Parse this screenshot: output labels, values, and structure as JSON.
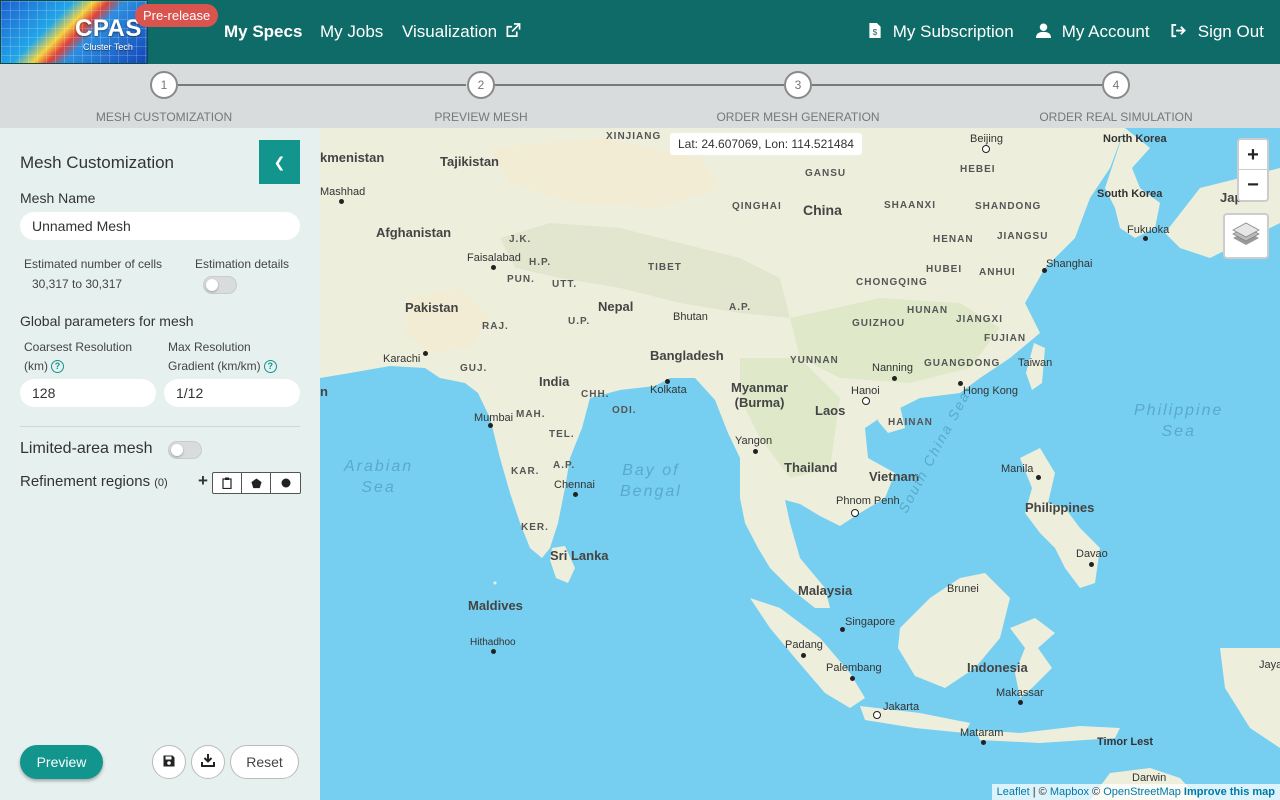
{
  "navbar": {
    "logo_text": "CPAS",
    "logo_sub": "Cluster Tech",
    "badge": "Pre-release",
    "links": [
      "My Specs",
      "My Jobs",
      "Visualization"
    ],
    "right_links": [
      "My Subscription",
      "My Account",
      "Sign Out"
    ]
  },
  "stepper": {
    "steps": [
      {
        "num": "1",
        "label": "MESH CUSTOMIZATION"
      },
      {
        "num": "2",
        "label": "PREVIEW MESH"
      },
      {
        "num": "3",
        "label": "ORDER MESH GENERATION"
      },
      {
        "num": "4",
        "label": "ORDER REAL SIMULATION"
      }
    ]
  },
  "sidebar": {
    "title": "Mesh Customization",
    "mesh_name_label": "Mesh Name",
    "mesh_name_value": "Unnamed Mesh",
    "est_cells_label": "Estimated number of cells",
    "est_cells_value": "30,317 to 30,317",
    "est_details_label": "Estimation details",
    "global_params": "Global parameters for mesh",
    "coarsest_label_1": "Coarsest Resolution",
    "coarsest_label_2": "(km)",
    "coarsest_value": "128",
    "max_grad_label_1": "Max Resolution",
    "max_grad_label_2": "Gradient (km/km)",
    "max_grad_value": "1/12",
    "limited_area": "Limited-area mesh",
    "refinement": "Refinement regions",
    "refinement_count": "(0)",
    "preview": "Preview",
    "reset": "Reset"
  },
  "map": {
    "coords": "Lat: 24.607069, Lon: 114.521484",
    "zoom_in": "+",
    "zoom_out": "−",
    "attribution": {
      "leaflet": "Leaflet",
      "sep1": " | © ",
      "mapbox": "Mapbox",
      "sep2": " © ",
      "osm": "OpenStreetMap",
      "improve": "Improve this map"
    },
    "labels": {
      "turkmenistan": "kmenistan",
      "tajikistan": "Tajikistan",
      "xinjiang": "XINJIANG",
      "beijing": "Beijing",
      "north_korea": "North Korea",
      "mashhad": "Mashhad",
      "gansu": "GANSU",
      "hebei": "HEBEI",
      "south_korea": "South Korea",
      "japan": "Japan",
      "qinghai": "QINGHAI",
      "china": "China",
      "shaanxi": "SHAANXI",
      "shandong": "SHANDONG",
      "afghanistan": "Afghanistan",
      "jk": "J.K.",
      "henan": "HENAN",
      "jiangsu": "JIANGSU",
      "fukuoka": "Fukuoka",
      "faisalabad": "Faisalabad",
      "hp": "H.P.",
      "tibet": "TIBET",
      "hubei": "HUBEI",
      "anhui": "ANHUI",
      "shanghai": "Shanghai",
      "pun": "PUN.",
      "utt": "UTT.",
      "chongqing": "CHONGQING",
      "pakistan": "Pakistan",
      "nepal": "Nepal",
      "ap_ne": "A.P.",
      "hunan": "HUNAN",
      "jiangxi": "JIANGXI",
      "raj": "RAJ.",
      "up": "U.P.",
      "bhutan": "Bhutan",
      "guizhou": "GUIZHOU",
      "fujian": "FUJIAN",
      "karachi": "Karachi",
      "bangladesh": "Bangladesh",
      "yunnan": "YUNNAN",
      "nanning": "Nanning",
      "guangdong": "GUANGDONG",
      "taiwan": "Taiwan",
      "guj": "GUJ.",
      "india": "India",
      "kolkata": "Kolkata",
      "myanmar": "Myanmar",
      "burma": "(Burma)",
      "hanoi": "Hanoi",
      "hong_kong": "Hong Kong",
      "chh": "CHH.",
      "odi": "ODI.",
      "laos": "Laos",
      "mumbai": "Mumbai",
      "mah": "MAH.",
      "hainan": "HAINAN",
      "philippine_sea": "Philippine",
      "philippine_sea2": "Sea",
      "tel": "TEL.",
      "yangon": "Yangon",
      "arabian": "Arabian",
      "arabian2": "Sea",
      "ap": "A.P.",
      "bay": "Bay of",
      "bay2": "Bengal",
      "thailand": "Thailand",
      "vietnam": "Vietnam",
      "manila": "Manila",
      "kar": "KAR.",
      "chennai": "Chennai",
      "philippines": "Philippines",
      "phnom_penh": "Phnom Penh",
      "south_china": "South China Sea",
      "ker": "KER.",
      "davao": "Davao",
      "sri_lanka": "Sri Lanka",
      "malaysia": "Malaysia",
      "brunei": "Brunei",
      "maldives": "Maldives",
      "singapore": "Singapore",
      "hithadhoo": "Hithadhoo",
      "padang": "Padang",
      "palembang": "Palembang",
      "indonesia": "Indonesia",
      "jayapura": "Jayapur",
      "makassar": "Makassar",
      "jakarta": "Jakarta",
      "mataram": "Mataram",
      "timor": "Timor Lest",
      "darwin": "Darwin",
      "west_edge": "n"
    }
  }
}
